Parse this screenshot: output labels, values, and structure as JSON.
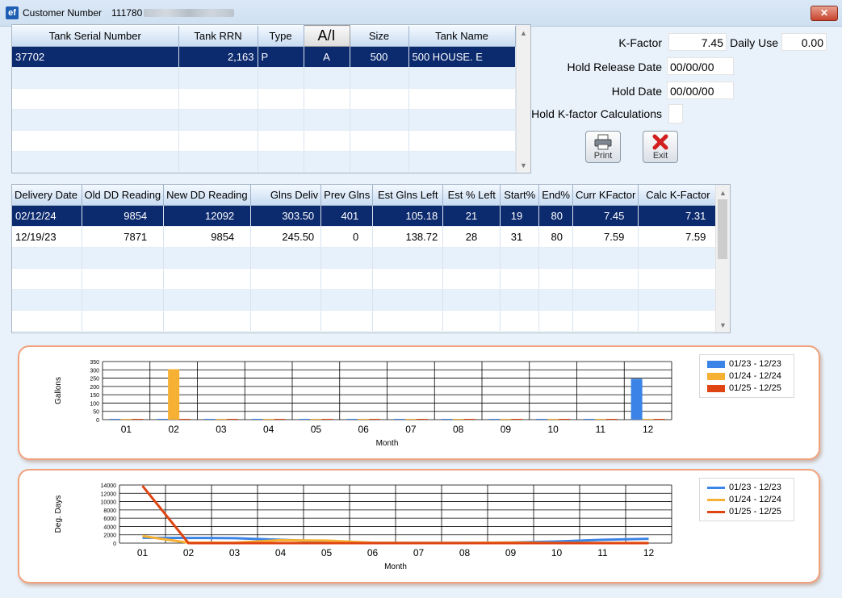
{
  "window": {
    "title": "Customer Number",
    "customer_number": "111780",
    "close_label": "✕"
  },
  "tank_table": {
    "headers": [
      "Tank Serial Number",
      "Tank RRN",
      "Type",
      "A/I",
      "Size",
      "Tank Name"
    ],
    "rows": [
      [
        "37702",
        "2,163",
        "P",
        "A",
        "500",
        "500 HOUSE. E"
      ]
    ]
  },
  "tank_form": {
    "kfactor_label": "K-Factor",
    "kfactor_value": "7.45",
    "daily_use_label": "Daily Use",
    "daily_use_value": "0.00",
    "hold_release_label": "Hold Release Date",
    "hold_release_value": "00/00/00",
    "hold_date_label": "Hold Date",
    "hold_date_value": "00/00/00",
    "hold_kfactor_label": "Hold K-factor Calculations"
  },
  "buttons": {
    "print_label": "Print",
    "exit_label": "Exit"
  },
  "icons": [
    "printer-icon",
    "exit-x-icon",
    "scroll-up-icon",
    "scroll-down-icon",
    "close-icon"
  ],
  "delivery_table": {
    "headers": [
      "Delivery Date",
      "Old DD Reading",
      "New DD Reading",
      "Glns Deliv",
      "Prev Glns",
      "Est Glns Left",
      "Est % Left",
      "Start%",
      "End%",
      "Curr KFactor",
      "Calc K-Factor"
    ],
    "rows": [
      [
        "02/12/24",
        "9854",
        "12092",
        "303.50",
        "401",
        "105.18",
        "21",
        "19",
        "80",
        "7.45",
        "7.31"
      ],
      [
        "12/19/23",
        "7871",
        "9854",
        "245.50",
        "0",
        "138.72",
        "28",
        "31",
        "80",
        "7.59",
        "7.59"
      ]
    ]
  },
  "colors": {
    "series1": "#3b83e6",
    "series2": "#f6b033",
    "series3": "#de4512",
    "selection": "#0c2a6e",
    "frame": "#f0a27d"
  },
  "chart_data": [
    {
      "type": "bar",
      "xlabel": "Month",
      "ylabel": "Gallons",
      "categories": [
        "01",
        "02",
        "03",
        "04",
        "05",
        "06",
        "07",
        "08",
        "09",
        "10",
        "11",
        "12"
      ],
      "yticks": [
        "0",
        "50",
        "100",
        "150",
        "200",
        "250",
        "300",
        "350"
      ],
      "ylim": [
        0,
        350
      ],
      "grid": true,
      "legend_position": "right",
      "series": [
        {
          "name": "01/23 - 12/23",
          "values": [
            0,
            0,
            0,
            0,
            0,
            0,
            0,
            0,
            0,
            0,
            0,
            246
          ]
        },
        {
          "name": "01/24 - 12/24",
          "values": [
            0,
            304,
            0,
            0,
            0,
            0,
            0,
            0,
            0,
            0,
            0,
            0
          ]
        },
        {
          "name": "01/25 - 12/25",
          "values": [
            0,
            0,
            0,
            0,
            0,
            0,
            0,
            0,
            0,
            0,
            0,
            0
          ]
        }
      ]
    },
    {
      "type": "line",
      "xlabel": "Month",
      "ylabel": "Deg. Days",
      "categories": [
        "01",
        "02",
        "03",
        "04",
        "05",
        "06",
        "07",
        "08",
        "09",
        "10",
        "11",
        "12"
      ],
      "yticks": [
        "0",
        "2000",
        "4000",
        "6000",
        "8000",
        "10000",
        "12000",
        "14000"
      ],
      "ylim": [
        0,
        14000
      ],
      "grid": true,
      "legend_position": "right",
      "series": [
        {
          "name": "01/23 - 12/23",
          "values": [
            1300,
            1250,
            1200,
            800,
            400,
            100,
            50,
            60,
            150,
            400,
            800,
            1050
          ]
        },
        {
          "name": "01/24 - 12/24",
          "values": [
            1700,
            100,
            100,
            700,
            600,
            100,
            50,
            60,
            150,
            50,
            50,
            50
          ]
        },
        {
          "name": "01/25 - 12/25",
          "values": [
            13800,
            0,
            0,
            0,
            0,
            0,
            0,
            0,
            0,
            0,
            0,
            0
          ]
        }
      ]
    }
  ]
}
